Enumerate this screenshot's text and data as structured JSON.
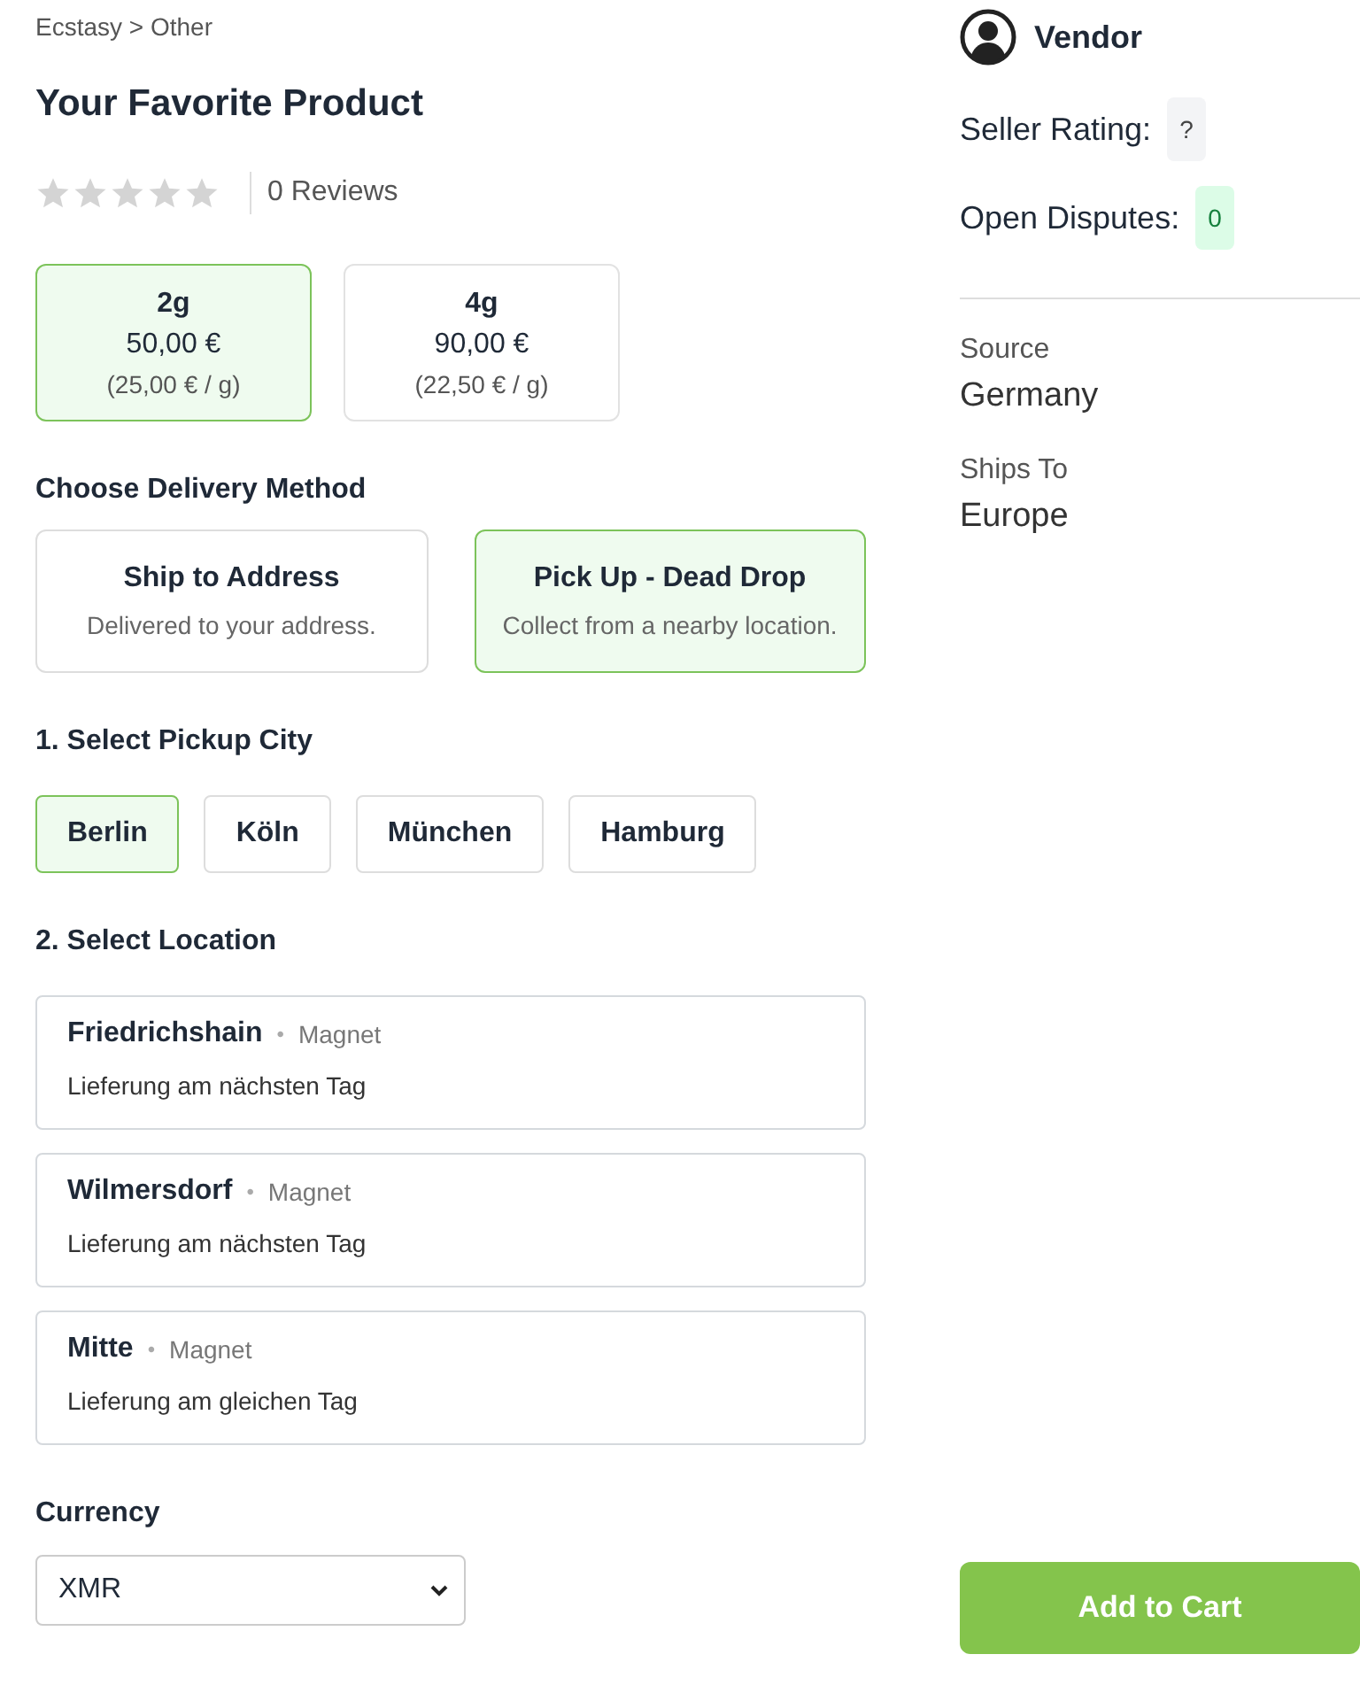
{
  "breadcrumb": "Ecstasy > Other",
  "product": {
    "title": "Your Favorite Product",
    "stars": 0,
    "reviews": "0 Reviews"
  },
  "options": [
    {
      "name": "2g",
      "price": "50,00 €",
      "unit_price": "(25,00 € / g)",
      "selected": true
    },
    {
      "name": "4g",
      "price": "90,00 €",
      "unit_price": "(22,50 € / g)",
      "selected": false
    }
  ],
  "delivery": {
    "heading": "Choose Delivery Method",
    "methods": [
      {
        "title": "Ship to Address",
        "subtitle": "Delivered to your address.",
        "selected": false
      },
      {
        "title": "Pick Up - Dead Drop",
        "subtitle": "Collect from a nearby location.",
        "selected": true
      }
    ]
  },
  "cities": {
    "heading": "1. Select Pickup City",
    "items": [
      {
        "label": "Berlin",
        "selected": true
      },
      {
        "label": "Köln",
        "selected": false
      },
      {
        "label": "München",
        "selected": false
      },
      {
        "label": "Hamburg",
        "selected": false
      }
    ]
  },
  "locations": {
    "heading": "2. Select Location",
    "items": [
      {
        "name": "Friedrichshain",
        "separator": "•",
        "type": "Magnet",
        "note": "Lieferung am nächsten Tag",
        "selected": false
      },
      {
        "name": "Wilmersdorf",
        "separator": "•",
        "type": "Magnet",
        "note": "Lieferung am nächsten Tag",
        "selected": false
      },
      {
        "name": "Mitte",
        "separator": "•",
        "type": "Magnet",
        "note": "Lieferung am gleichen Tag",
        "selected": false
      }
    ]
  },
  "currency": {
    "label": "Currency",
    "value": "XMR"
  },
  "vendor": {
    "name": "Vendor",
    "rating_label": "Seller Rating:",
    "rating": "?",
    "disputes_label": "Open Disputes:",
    "disputes": "0"
  },
  "details": [
    {
      "label": "Source",
      "value": "Germany"
    },
    {
      "label": "Ships To",
      "value": "Europe"
    }
  ],
  "add_to_cart": "Add to Cart"
}
